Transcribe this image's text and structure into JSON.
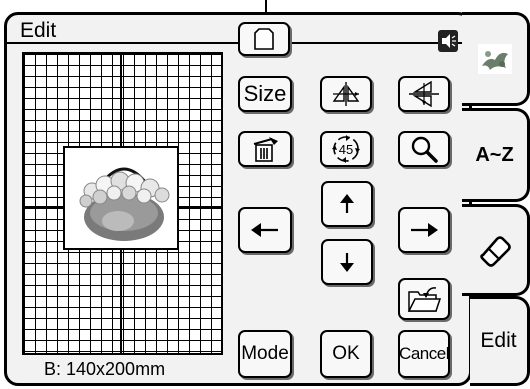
{
  "header": {
    "title": "Edit",
    "sound_icon": "speaker-icon"
  },
  "canvas": {
    "size_label": "B: 140x200mm"
  },
  "toolbar": {
    "pattern_icon": "pattern-select-icon",
    "size_label": "Size",
    "flip_horizontal_icon": "mirror-horizontal-icon",
    "flip_vertical_icon": "mirror-vertical-icon",
    "delete_icon": "delete-icon",
    "rotate_label": "45",
    "zoom_icon": "magnifier-icon",
    "up_icon": "arrow-up-icon",
    "down_icon": "arrow-down-icon",
    "left_icon": "arrow-left-icon",
    "right_icon": "arrow-right-icon",
    "save_icon": "folder-save-icon",
    "mode_label": "Mode",
    "ok_label": "OK",
    "cancel_label": "Cancel"
  },
  "tabs": [
    {
      "name": "embroidery-pattern-tab",
      "label": ""
    },
    {
      "name": "character-tab",
      "label": "A~Z"
    },
    {
      "name": "eraser-tab",
      "label": ""
    },
    {
      "name": "edit-tab",
      "label": "Edit"
    }
  ]
}
